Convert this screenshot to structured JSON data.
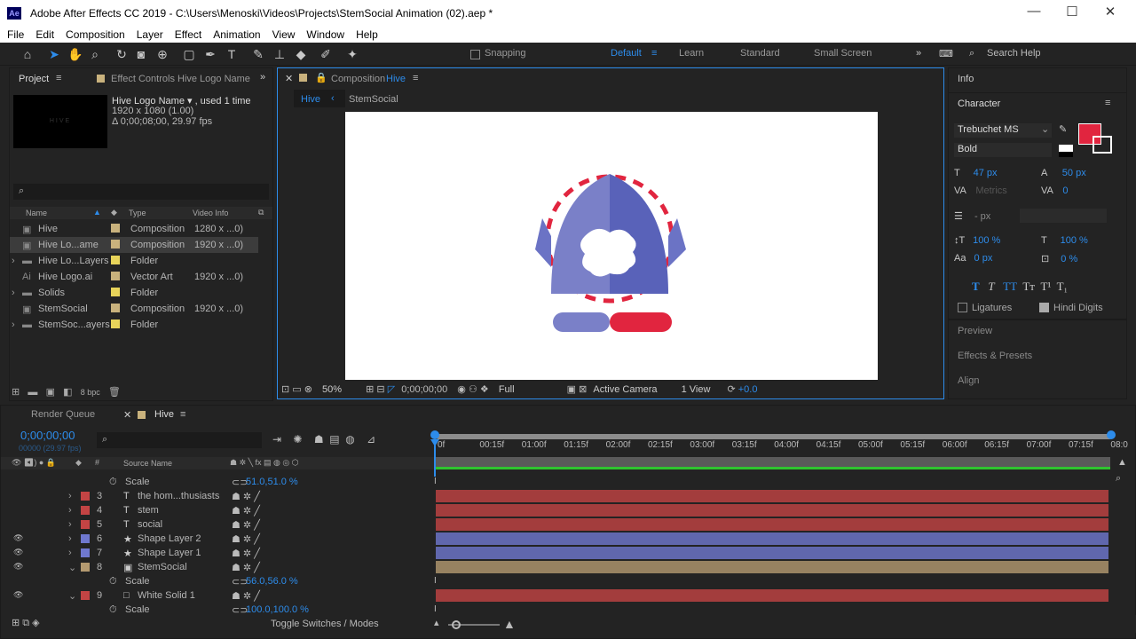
{
  "window": {
    "title": "Adobe After Effects CC 2019 - C:\\Users\\Menoski\\Videos\\Projects\\StemSocial Animation (02).aep *",
    "app_badge": "Ae",
    "minimize": "—",
    "maximize": "☐",
    "close": "✕"
  },
  "menu": [
    "File",
    "Edit",
    "Composition",
    "Layer",
    "Effect",
    "Animation",
    "View",
    "Window",
    "Help"
  ],
  "toolbar": {
    "snapping": "Snapping",
    "workspaces": [
      "Default",
      "Learn",
      "Standard",
      "Small Screen"
    ],
    "search_placeholder": "Search Help"
  },
  "project": {
    "tab": "Project",
    "effect_tab": "Effect Controls Hive Logo Name",
    "preview_label": "HIVE",
    "selected_name": "Hive Logo Name ▾ , used 1 time",
    "selected_size": "1920 x 1080 (1.00)",
    "selected_duration": "Δ 0;00;08;00, 29.97 fps",
    "columns": {
      "name": "Name",
      "type": "Type",
      "video": "Video Info"
    },
    "items": [
      {
        "name": "Hive",
        "type": "Composition",
        "info": "1280 x ...0)",
        "color": "#c9b27d"
      },
      {
        "name": "Hive Lo...ame",
        "type": "Composition",
        "info": "1920 x ...0)",
        "color": "#c9b27d"
      },
      {
        "name": "Hive Lo...Layers",
        "type": "Folder",
        "info": "",
        "color": "#e8d45a"
      },
      {
        "name": "Hive Logo.ai",
        "type": "Vector Art",
        "info": "1920 x ...0)",
        "color": "#c9b27d"
      },
      {
        "name": "Solids",
        "type": "Folder",
        "info": "",
        "color": "#e8d45a"
      },
      {
        "name": "StemSocial",
        "type": "Composition",
        "info": "1920 x ...0)",
        "color": "#c9b27d"
      },
      {
        "name": "StemSoc...ayers",
        "type": "Folder",
        "info": "",
        "color": "#e8d45a"
      }
    ],
    "bpc": "8 bpc"
  },
  "comp": {
    "tab_prefix": "Composition",
    "tab_name": "Hive",
    "breadcrumbs": [
      "Hive",
      "StemSocial"
    ],
    "zoom": "50%",
    "timecode": "0;00;00;00",
    "resolution": "Full",
    "camera": "Active Camera",
    "views": "1 View",
    "exposure": "+0.0"
  },
  "right": {
    "info": "Info",
    "character": "Character",
    "font": "Trebuchet MS",
    "style": "Bold",
    "font_size": "47 px",
    "leading": "50 px",
    "kerning": "Metrics",
    "tracking": "0",
    "stroke": "- px",
    "vscale": "100 %",
    "hscale": "100 %",
    "baseline": "0 px",
    "tsume": "0 %",
    "ligatures": "Ligatures",
    "hindi": "Hindi Digits",
    "sections": [
      "Preview",
      "Effects & Presets",
      "Align"
    ]
  },
  "timeline": {
    "render_tab": "Render Queue",
    "comp_tab": "Hive",
    "timecode": "0;00;00;00",
    "fps": "00000 (29.97 fps)",
    "source_name": "Source Name",
    "ruler": [
      "0f",
      "00:15f",
      "01:00f",
      "01:15f",
      "02:00f",
      "02:15f",
      "03:00f",
      "03:15f",
      "04:00f",
      "04:15f",
      "05:00f",
      "05:15f",
      "06:00f",
      "06:15f",
      "07:00f",
      "07:15f",
      "08:0"
    ],
    "rows": [
      {
        "kind": "prop",
        "label": "Scale",
        "value": "51.0,51.0 %"
      },
      {
        "kind": "layer",
        "num": "3",
        "icon": "T",
        "name": "the hom...thusiasts",
        "color": "#c34444"
      },
      {
        "kind": "layer",
        "num": "4",
        "icon": "T",
        "name": "stem",
        "color": "#c34444"
      },
      {
        "kind": "layer",
        "num": "5",
        "icon": "T",
        "name": "social",
        "color": "#c34444"
      },
      {
        "kind": "layer",
        "num": "6",
        "icon": "★",
        "name": "Shape Layer 2",
        "color": "#6f78cf"
      },
      {
        "kind": "layer",
        "num": "7",
        "icon": "★",
        "name": "Shape Layer 1",
        "color": "#6f78cf"
      },
      {
        "kind": "layer",
        "num": "8",
        "icon": "▣",
        "name": "StemSocial",
        "color": "#b49a70"
      },
      {
        "kind": "prop",
        "label": "Scale",
        "value": "56.0,56.0 %"
      },
      {
        "kind": "layer",
        "num": "9",
        "icon": "□",
        "name": "White Solid 1",
        "color": "#c34444"
      },
      {
        "kind": "prop",
        "label": "Scale",
        "value": "100.0,100.0 %"
      }
    ],
    "toggle": "Toggle Switches / Modes"
  }
}
